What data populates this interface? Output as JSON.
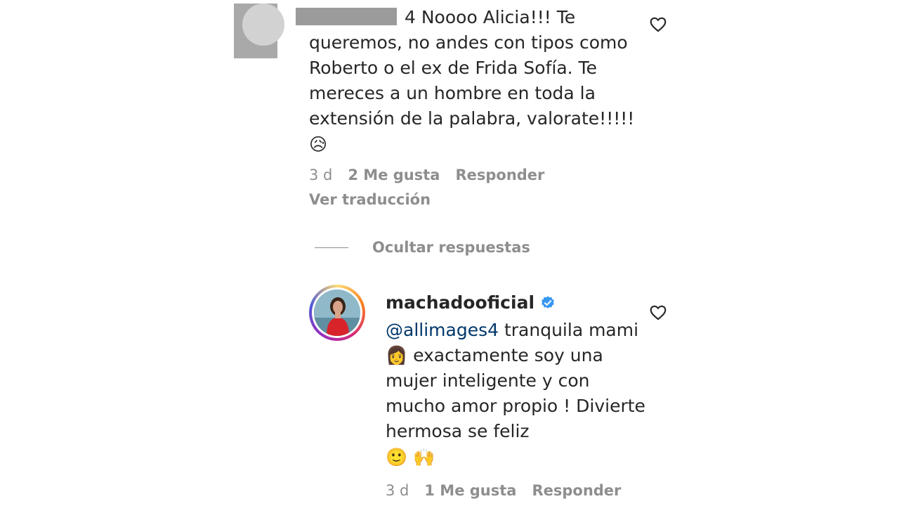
{
  "comment": {
    "username_redacted": true,
    "username_visible_fragment": "4",
    "text": "Noooo Alicia!!! Te queremos, no andes con tipos como Roberto o el ex de Frida Sofía. Te mereces a un hombre en toda la extensión de la palabra, valorate!!!!!",
    "emoji": "😥",
    "time": "3 d",
    "likes": "2 Me gusta",
    "reply_label": "Responder",
    "translate_label": "Ver traducción"
  },
  "thread": {
    "hide_replies_label": "Ocultar respuestas"
  },
  "reply": {
    "username": "machadooficial",
    "verified": true,
    "mention": "@allimages4",
    "text": " tranquila mami 👩 exactamente soy una mujer inteligente y con mucho amor propio ! Divierte hermosa se feliz",
    "emojis": "🙂 🙌",
    "time": "3 d",
    "likes": "1 Me gusta",
    "reply_label": "Responder"
  },
  "colors": {
    "text": "#262626",
    "muted": "#8e8e8e",
    "mention": "#00376b",
    "verified": "#3897f0"
  }
}
